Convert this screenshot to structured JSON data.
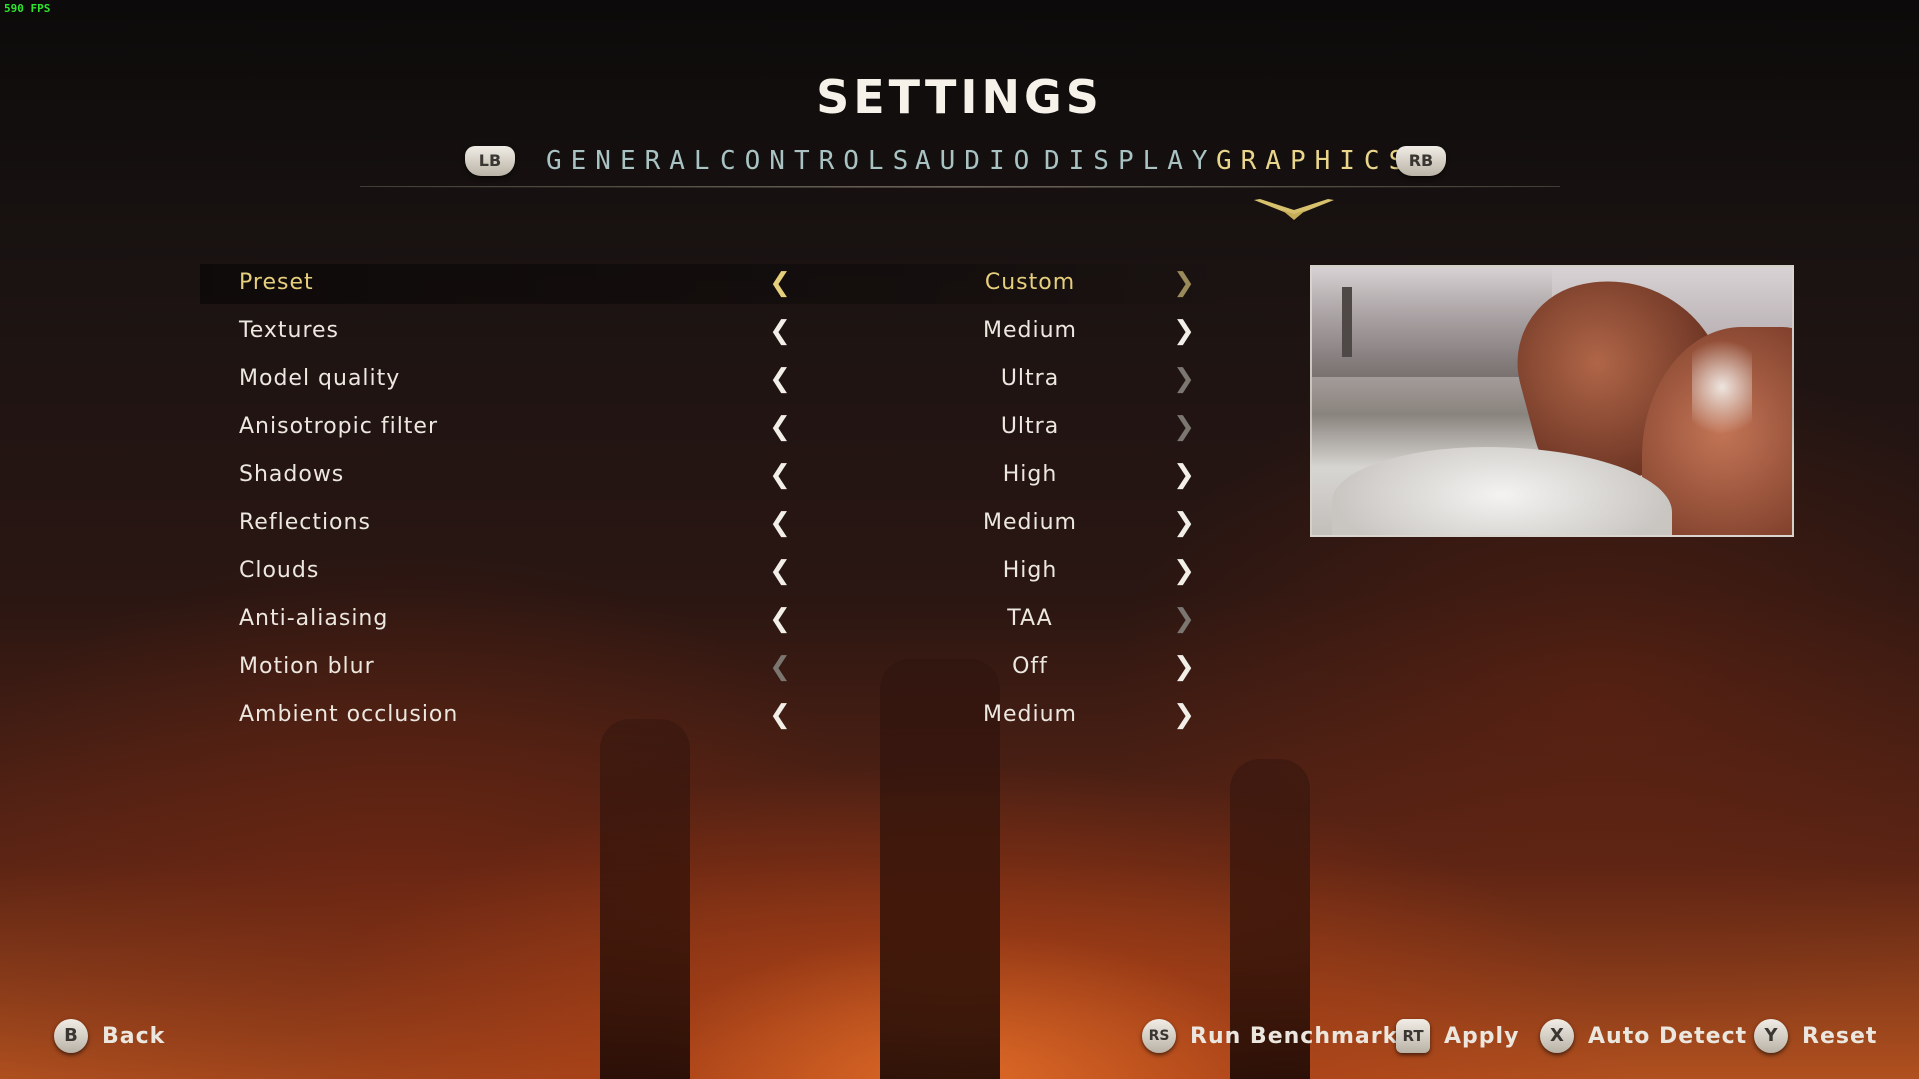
{
  "overlay": {
    "fps": "590 FPS"
  },
  "header": {
    "title": "SETTINGS"
  },
  "tabs": {
    "prev_bumper": "LB",
    "next_bumper": "RB",
    "items": [
      {
        "label": "GENERAL",
        "active": false
      },
      {
        "label": "CONTROLS",
        "active": false
      },
      {
        "label": "AUDIO",
        "active": false
      },
      {
        "label": "DISPLAY",
        "active": false
      },
      {
        "label": "GRAPHICS",
        "active": true
      }
    ]
  },
  "settings": [
    {
      "label": "Preset",
      "value": "Custom",
      "selected": true,
      "left_enabled": true,
      "right_enabled": false
    },
    {
      "label": "Textures",
      "value": "Medium",
      "selected": false,
      "left_enabled": true,
      "right_enabled": true
    },
    {
      "label": "Model quality",
      "value": "Ultra",
      "selected": false,
      "left_enabled": true,
      "right_enabled": false
    },
    {
      "label": "Anisotropic filter",
      "value": "Ultra",
      "selected": false,
      "left_enabled": true,
      "right_enabled": false
    },
    {
      "label": "Shadows",
      "value": "High",
      "selected": false,
      "left_enabled": true,
      "right_enabled": true
    },
    {
      "label": "Reflections",
      "value": "Medium",
      "selected": false,
      "left_enabled": true,
      "right_enabled": true
    },
    {
      "label": "Clouds",
      "value": "High",
      "selected": false,
      "left_enabled": true,
      "right_enabled": true
    },
    {
      "label": "Anti-aliasing",
      "value": "TAA",
      "selected": false,
      "left_enabled": true,
      "right_enabled": false
    },
    {
      "label": "Motion blur",
      "value": "Off",
      "selected": false,
      "left_enabled": false,
      "right_enabled": true
    },
    {
      "label": "Ambient occlusion",
      "value": "Medium",
      "selected": false,
      "left_enabled": true,
      "right_enabled": true
    }
  ],
  "arrows": {
    "left": "❮",
    "right": "❯"
  },
  "footer": {
    "back": {
      "glyph": "B",
      "label": "Back"
    },
    "benchmark": {
      "glyph": "RS",
      "label": "Run Benchmark"
    },
    "apply": {
      "glyph": "RT",
      "label": "Apply"
    },
    "auto_detect": {
      "glyph": "X",
      "label": "Auto Detect"
    },
    "reset": {
      "glyph": "Y",
      "label": "Reset"
    }
  },
  "colors": {
    "accent": "#e6cf7c",
    "tab_inactive": "#a9c3c3",
    "text": "#ece7df"
  }
}
